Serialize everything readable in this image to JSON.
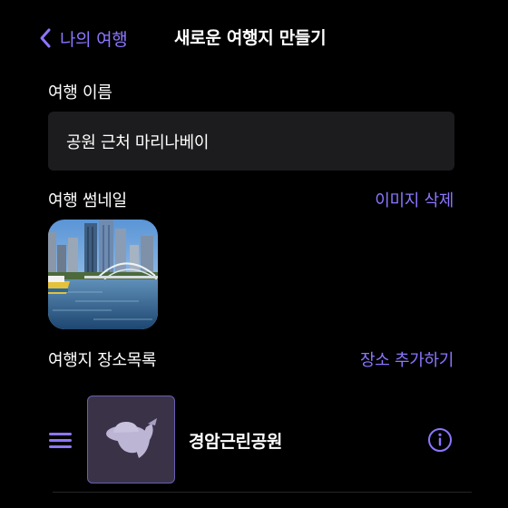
{
  "nav": {
    "back_label": "나의 여행",
    "title": "새로운 여행지 만들기",
    "back_icon": "chevron-left-icon"
  },
  "trip_name": {
    "label": "여행 이름",
    "value": "공원 근처 마리나베이"
  },
  "thumbnail": {
    "label": "여행 썸네일",
    "delete_label": "이미지 삭제"
  },
  "places": {
    "label": "여행지 장소목록",
    "add_label": "장소 추가하기",
    "items": [
      {
        "name": "경암근린공원",
        "thumb_icon": "hat-placeholder-icon",
        "handle_icon": "drag-handle-icon",
        "info_icon": "info-icon"
      }
    ]
  },
  "colors": {
    "accent": "#8d76ff",
    "background": "#000000",
    "field": "#1c1c1e",
    "place_thumb_bg": "#3a3348",
    "place_thumb_border": "#6b5fb3"
  }
}
